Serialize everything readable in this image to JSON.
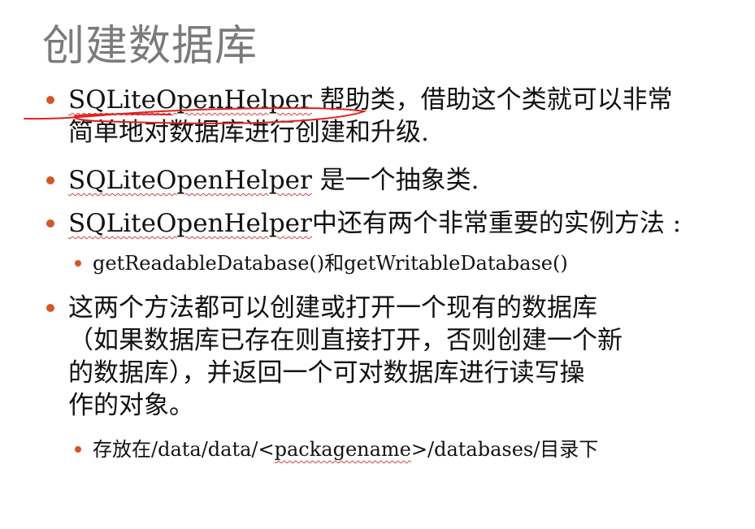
{
  "slide": {
    "title": "创建数据库",
    "bullets": [
      {
        "term": "SQLiteOpenHelper",
        "text_line1": " 帮助类，借助这个类就可以非常",
        "text_line2": "简单地对数据库进行创建和升级."
      },
      {
        "term": "SQLiteOpenHelper",
        "text": " 是一个抽象类."
      },
      {
        "term": "SQLiteOpenHelper",
        "text": "中还有两个非常重要的实例方法 :",
        "sub": {
          "method1": "getReadableDatabase()",
          "connector": "和",
          "method2": "getWritableDatabase()"
        }
      },
      {
        "lines": [
          "这两个方法都可以创建或打开一个现有的数据库",
          "（如果数据库已存在则直接打开，否则创建一个新",
          "的数据库），并返回一个可对数据库进行读写操",
          "作的对象。"
        ],
        "sub": {
          "prefix": "存放在/data/data/<",
          "term": "packagename",
          "suffix": ">/databases/目录下"
        }
      }
    ]
  },
  "colors": {
    "title": "#7b7b7b",
    "bullet": "#d0582a",
    "annotation_ink": "#e02020",
    "spellcheck": "#d04040"
  }
}
